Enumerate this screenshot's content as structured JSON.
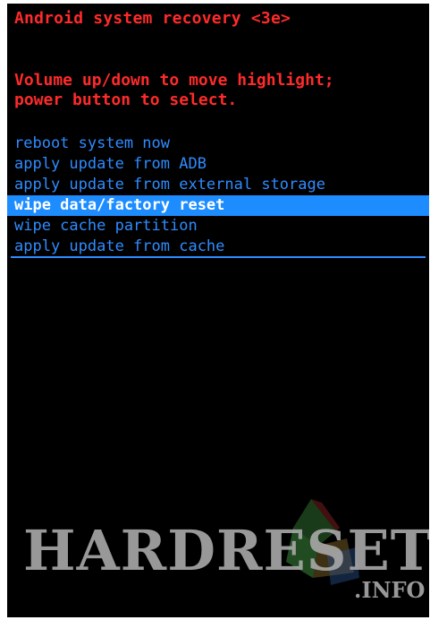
{
  "header": {
    "title": "Android system recovery <3e>"
  },
  "instructions": {
    "line1": "Volume up/down to move highlight;",
    "line2": "power button to select."
  },
  "menu": {
    "selected_index": 3,
    "items": [
      {
        "label": "reboot system now"
      },
      {
        "label": "apply update from ADB"
      },
      {
        "label": "apply update from external storage"
      },
      {
        "label": "wipe data/factory reset"
      },
      {
        "label": "wipe cache partition"
      },
      {
        "label": "apply update from cache"
      }
    ]
  },
  "watermark": {
    "brand": "HARDRESET",
    "suffix": ".INFO"
  },
  "colors": {
    "background": "#000000",
    "title_text": "#ff2a2a",
    "menu_text": "#2f8cff",
    "highlight": "#1d8cff"
  }
}
